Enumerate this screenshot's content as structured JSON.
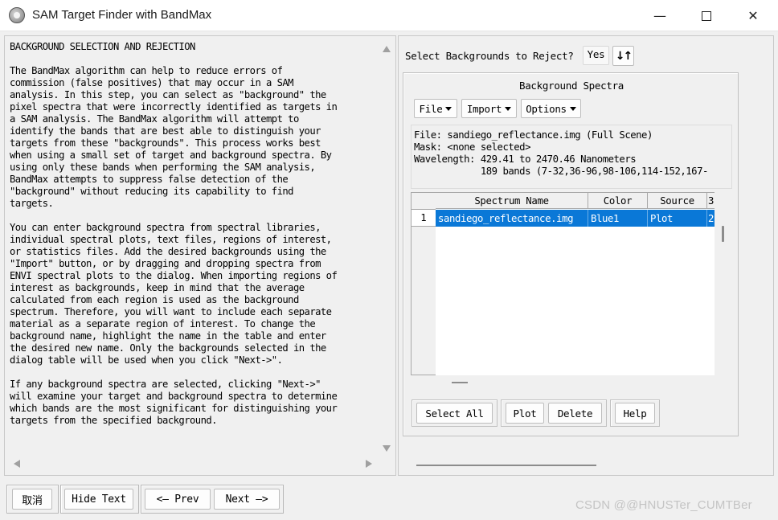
{
  "window": {
    "title": "SAM Target Finder with BandMax",
    "minimize": "—",
    "close": "✕"
  },
  "help": {
    "text": "BACKGROUND SELECTION AND REJECTION\n\nThe BandMax algorithm can help to reduce errors of\ncommission (false positives) that may occur in a SAM\nanalysis. In this step, you can select as \"background\" the\npixel spectra that were incorrectly identified as targets in\na SAM analysis. The BandMax algorithm will attempt to\nidentify the bands that are best able to distinguish your\ntargets from these \"backgrounds\". This process works best\nwhen using a small set of target and background spectra. By\nusing only these bands when performing the SAM analysis,\nBandMax attempts to suppress false detection of the\n\"background\" without reducing its capability to find\ntargets.\n\nYou can enter background spectra from spectral libraries,\nindividual spectral plots, text files, regions of interest,\nor statistics files. Add the desired backgrounds using the\n\"Import\" button, or by dragging and dropping spectra from\nENVI spectral plots to the dialog. When importing regions of\ninterest as backgrounds, keep in mind that the average\ncalculated from each region is used as the background\nspectrum. Therefore, you will want to include each separate\nmaterial as a separate region of interest. To change the\nbackground name, highlight the name in the table and enter\nthe desired new name. Only the backgrounds selected in the\ndialog table will be used when you click \"Next->\".\n\nIf any background spectra are selected, clicking \"Next->\"\nwill examine your target and background spectra to determine\nwhich bands are the most significant for distinguishing your\ntargets from the specified background."
  },
  "reject": {
    "label": "Select Backgrounds to Reject?",
    "value": "Yes",
    "sort_glyph": "↓↑"
  },
  "background": {
    "title": "Background Spectra",
    "menus": {
      "file": "File",
      "import": "Import",
      "options": "Options"
    },
    "info": {
      "file": "File: sandiego_reflectance.img (Full Scene)",
      "mask": "Mask: <none selected>",
      "wavelength": "Wavelength: 429.41 to 2470.46 Nanometers",
      "bands": "            189 bands (7-32,36-96,98-106,114-152,167-"
    },
    "table": {
      "headers": [
        "Spectrum Name",
        "Color",
        "Source",
        "3"
      ],
      "rows": [
        {
          "index": "1",
          "name": "sandiego_reflectance.img",
          "color": "Blue1",
          "source": "Plot",
          "extra": "2"
        }
      ]
    },
    "buttons": {
      "select_all": "Select All",
      "plot": "Plot",
      "delete": "Delete",
      "help": "Help"
    }
  },
  "footer": {
    "cancel": "取消",
    "hide_text": "Hide Text",
    "prev": "<— Prev",
    "next": "Next —>"
  },
  "watermark": "CSDN @@HNUSTer_CUMTBer"
}
